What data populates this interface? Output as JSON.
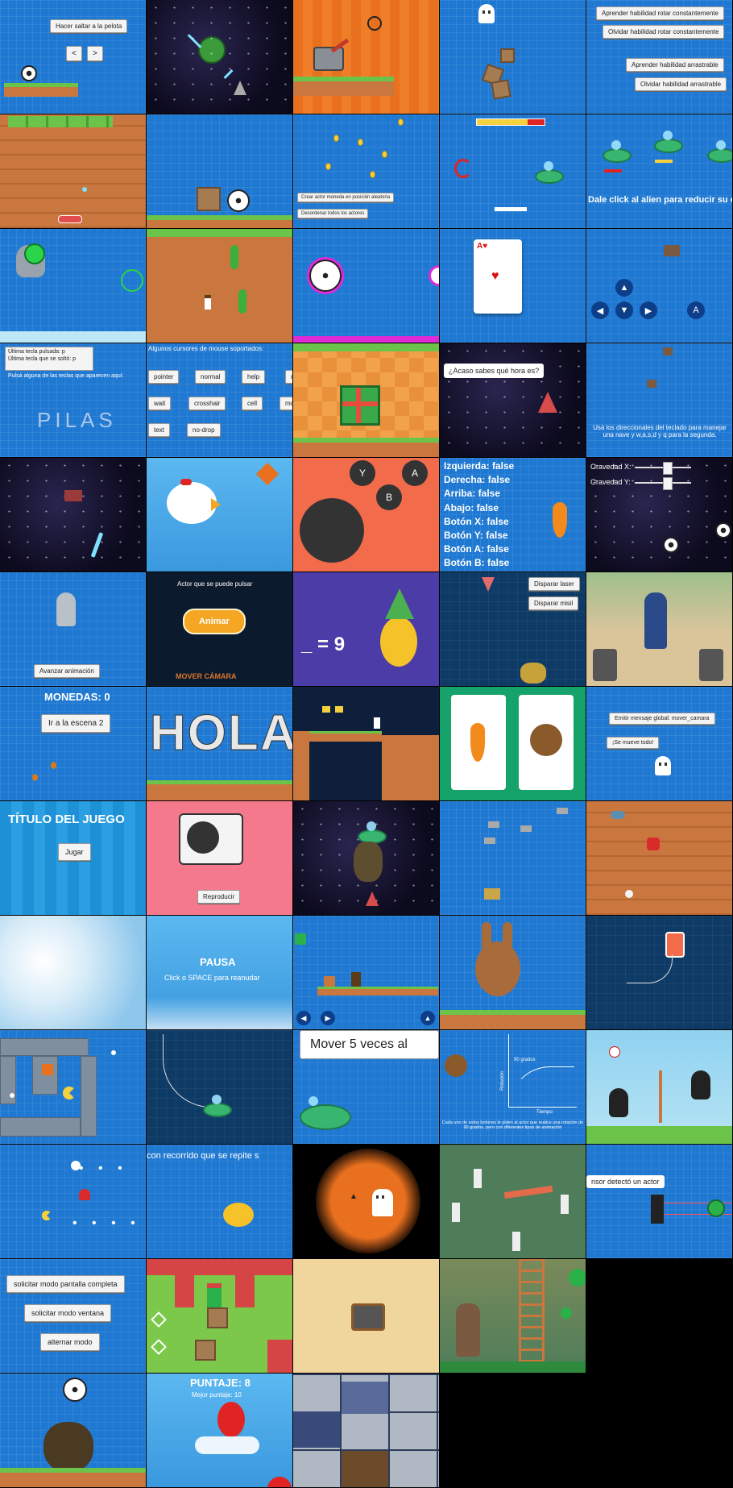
{
  "colors": {
    "background": "#000000",
    "tile_blue": "#1f78d1",
    "button": "#f4f4f4",
    "accent_green": "#6cc34a"
  },
  "t1": {
    "jump": "Hacer saltar a la pelota",
    "left": "<",
    "right": ">"
  },
  "t5": {
    "b1": "Aprender habilidad rotar constantemente",
    "b2": "Olvidar habilidad rotar constantemente",
    "b3": "Aprender habilidad arrastrable",
    "b4": "Olvidar habilidad arrastrable"
  },
  "t8": {
    "create": "Crear actor moneda en posición aleatoria",
    "destroy": "Desordenar todos los actores"
  },
  "t10": {
    "hint": "Dale click al alien para reducir su e"
  },
  "t15": {
    "up": "▲",
    "left": "◀",
    "down": "▼",
    "right": "▶",
    "a": "A"
  },
  "t16": {
    "last_pressed": "Última tecla pulsada: p",
    "last_released": "Última tecla que se soltó: p",
    "prompt": "Pulsá alguna de las teclas que aparecen aquí:",
    "logo": "PILAS"
  },
  "t17": {
    "title": "Algunos cursores de mouse soportados:",
    "cursors": [
      "pointer",
      "normal",
      "help",
      "n",
      "wait",
      "crosshair",
      "cell",
      "mov",
      "text",
      "no-drop"
    ]
  },
  "t19": {
    "question": "¿Acaso sabes qué hora es?"
  },
  "t20": {
    "instructions": "Usá los direccionales del teclado para manejar una nave y w,a,s,d y q para la segunda."
  },
  "t23": {
    "y": "Y",
    "a": "A",
    "b": "B"
  },
  "t24": {
    "lines": [
      "Izquierda: false",
      "Derecha: false",
      "Arriba: false",
      "Abajo: false",
      "Botón X: false",
      "Botón Y: false",
      "Botón A: false",
      "Botón B: false"
    ]
  },
  "t25": {
    "gx": "Gravedad X:",
    "gy": "Gravedad Y:"
  },
  "t26": {
    "advance": "Avanzar animación"
  },
  "t27": {
    "caption": "Actor que se puede pulsar",
    "animate": "Animar",
    "move_camera": "MOVER CÁMARA"
  },
  "t28": {
    "equation": "_ = 9"
  },
  "t29": {
    "laser": "Disparar laser",
    "missile": "Disparar misil"
  },
  "t31": {
    "coins": "MONEDAS: 0",
    "scene2": "Ir a la escena 2"
  },
  "t32": {
    "word": "HOLA"
  },
  "t35": {
    "emit": "Emitir mensaje global: mover_camara",
    "moved": "¡Se mueve todo!"
  },
  "t36": {
    "title": "TÍTULO DEL JUEGO",
    "play": "Jugar"
  },
  "t37": {
    "play": "Reproducir"
  },
  "t42": {
    "pause": "PAUSA",
    "resume": "Click o SPACE para reanudar"
  },
  "t48": {
    "banner": "Mover 5 veces al"
  },
  "t49": {
    "label": "90 grados",
    "ylabel": "Rotación",
    "xlabel": "Tiempo",
    "caption": "Cada uno de estos botones le piden al actor que realice una rotación de 90 grados, pero con diferentes tipos de animación"
  },
  "t52": {
    "caption": "con recorrido que se repite s"
  },
  "t55": {
    "sensor": "nsor detectó un actor"
  },
  "t56": {
    "fullscreen": "solicitar modo pantalla completa",
    "window": "solicitar modo ventana",
    "toggle": "alternar modo"
  },
  "t62": {
    "score": "PUNTAJE: 8",
    "best": "Mejor puntaje: 10"
  }
}
